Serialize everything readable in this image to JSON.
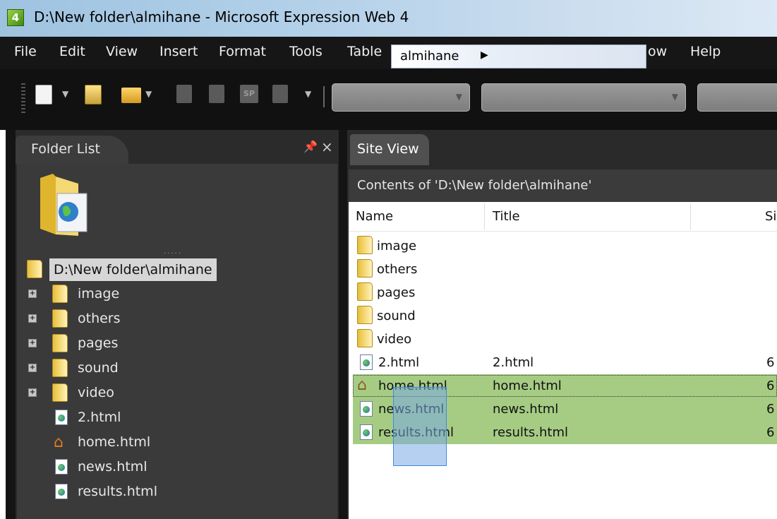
{
  "window": {
    "title": "D:\\New folder\\almihane - Microsoft Expression Web 4",
    "app_icon_letter": "4"
  },
  "menu": [
    "File",
    "Edit",
    "View",
    "Insert",
    "Format",
    "Tools",
    "Table",
    "ow",
    "Help"
  ],
  "breadcrumb_popup": {
    "label": "almihane"
  },
  "folder_list": {
    "tab_label": "Folder List",
    "root": "D:\\New folder\\almihane",
    "items": [
      {
        "label": "image",
        "type": "folder"
      },
      {
        "label": "others",
        "type": "folder"
      },
      {
        "label": "pages",
        "type": "folder"
      },
      {
        "label": "sound",
        "type": "folder"
      },
      {
        "label": "video",
        "type": "folder"
      },
      {
        "label": "2.html",
        "type": "file"
      },
      {
        "label": "home.html",
        "type": "home"
      },
      {
        "label": "news.html",
        "type": "file"
      },
      {
        "label": "results.html",
        "type": "file"
      }
    ]
  },
  "site_view": {
    "tab_label": "Site View",
    "path_label": "Contents of 'D:\\New folder\\almihane'",
    "columns": [
      "Name",
      "Title",
      "Si"
    ],
    "rows": [
      {
        "name": "image",
        "title": "",
        "size": "",
        "type": "folder"
      },
      {
        "name": "others",
        "title": "",
        "size": "",
        "type": "folder"
      },
      {
        "name": "pages",
        "title": "",
        "size": "",
        "type": "folder"
      },
      {
        "name": "sound",
        "title": "",
        "size": "",
        "type": "folder"
      },
      {
        "name": "video",
        "title": "",
        "size": "",
        "type": "folder"
      },
      {
        "name": "2.html",
        "title": "2.html",
        "size": "6",
        "type": "file"
      },
      {
        "name": "home.html",
        "title": "home.html",
        "size": "6",
        "type": "home",
        "selected": true
      },
      {
        "name": "news.html",
        "title": "news.html",
        "size": "6",
        "type": "file",
        "selected": true
      },
      {
        "name": "results.html",
        "title": "results.html",
        "size": "6",
        "type": "file",
        "selected": true
      }
    ]
  }
}
